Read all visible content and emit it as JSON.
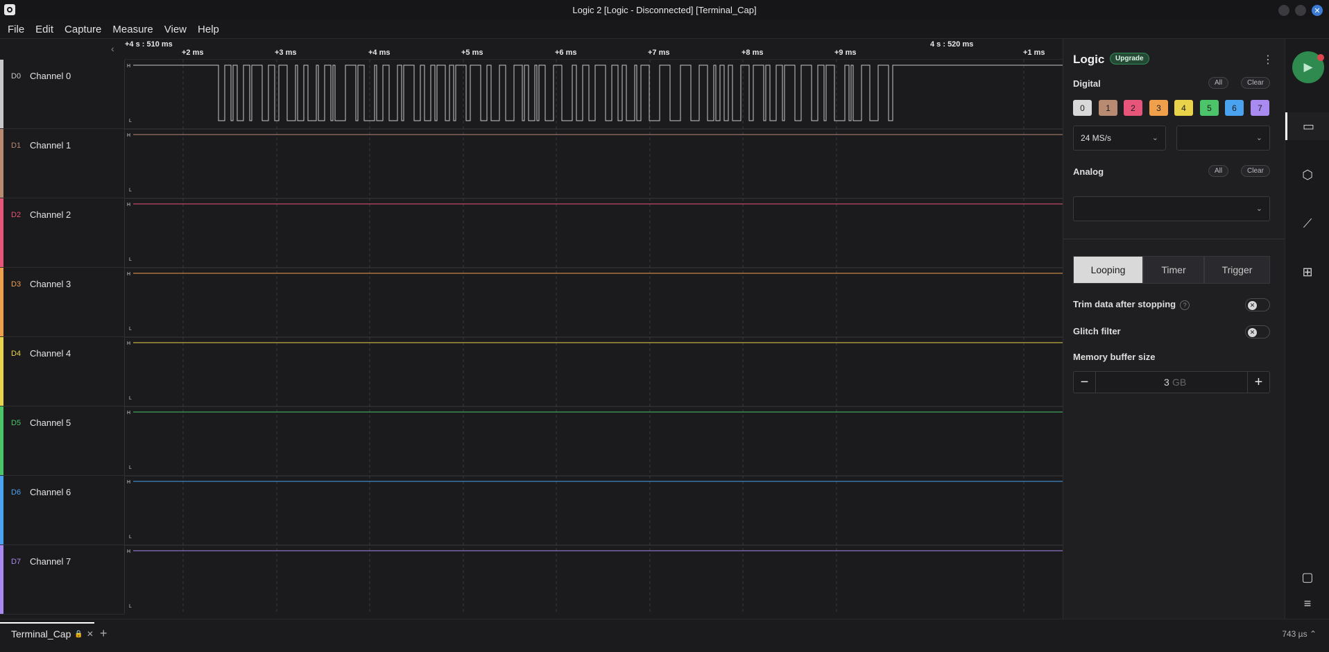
{
  "window": {
    "title": "Logic 2 [Logic - Disconnected] [Terminal_Cap]"
  },
  "menu": [
    "File",
    "Edit",
    "Capture",
    "Measure",
    "View",
    "Help"
  ],
  "timeline": {
    "ticks": [
      "+4 s : 510 ms",
      "+2 ms",
      "+3 ms",
      "+4 ms",
      "+5 ms",
      "+6 ms",
      "+7 ms",
      "+8 ms",
      "+9 ms",
      "4 s : 520 ms",
      "+1 ms"
    ]
  },
  "channels": [
    {
      "code": "D0",
      "name": "Channel 0",
      "color": "#c8c8c8"
    },
    {
      "code": "D1",
      "name": "Channel 1",
      "color": "#b88a72"
    },
    {
      "code": "D2",
      "name": "Channel 2",
      "color": "#e8557a"
    },
    {
      "code": "D3",
      "name": "Channel 3",
      "color": "#f0a04b"
    },
    {
      "code": "D4",
      "name": "Channel 4",
      "color": "#e9d34a"
    },
    {
      "code": "D5",
      "name": "Channel 5",
      "color": "#4bc46a"
    },
    {
      "code": "D6",
      "name": "Channel 6",
      "color": "#4aa3f0"
    },
    {
      "code": "D7",
      "name": "Channel 7",
      "color": "#a98af0"
    }
  ],
  "signal_markers": {
    "high": "H",
    "low": "L"
  },
  "panel": {
    "title": "Logic",
    "upgrade": "Upgrade",
    "digital_label": "Digital",
    "analog_label": "Analog",
    "all": "All",
    "clear": "Clear",
    "digital_buttons": [
      "0",
      "1",
      "2",
      "3",
      "4",
      "5",
      "6",
      "7"
    ],
    "sample_rate": "24 MS/s",
    "modes": [
      "Looping",
      "Timer",
      "Trigger"
    ],
    "active_mode": "Looping",
    "trim_label": "Trim data after stopping",
    "glitch_label": "Glitch filter",
    "memory_label": "Memory buffer size",
    "memory_value": "3",
    "memory_unit": "GB"
  },
  "bottom": {
    "tab_name": "Terminal_Cap",
    "zoom": "743 µs"
  },
  "icons": {
    "run": "play-icon",
    "rail": [
      "device-icon",
      "analyzers-icon",
      "measure-icon",
      "extensions-icon",
      "comment-icon",
      "menu-icon"
    ]
  }
}
